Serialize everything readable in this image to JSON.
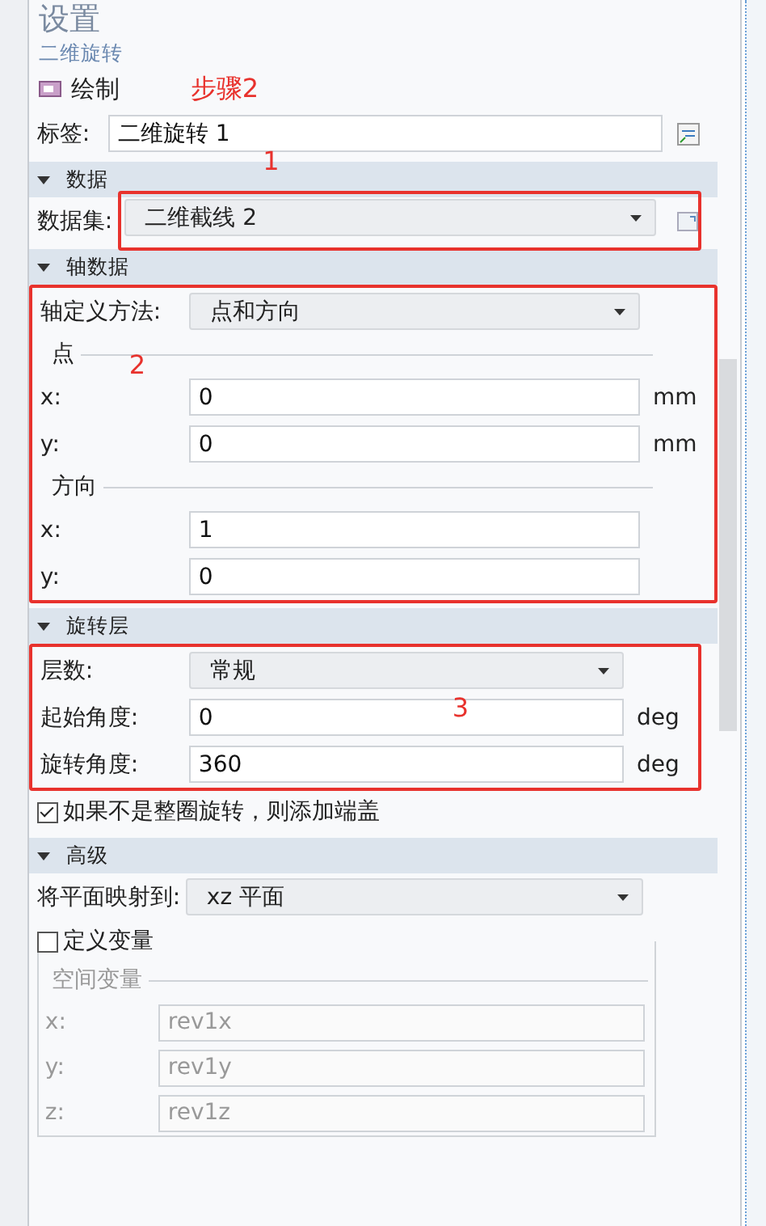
{
  "panel": {
    "title": "设置",
    "subtitle": "二维旋转",
    "action": "绘制",
    "annotation": "步骤2"
  },
  "label_field": {
    "label": "标签:",
    "value": "二维旋转 1"
  },
  "sections": [
    {
      "title": "数据",
      "expanded": true,
      "items": [
        {
          "kind": "combo",
          "label": "数据集:",
          "value": "二维截线 2",
          "highlight": "1"
        }
      ]
    },
    {
      "title": "轴数据",
      "expanded": true,
      "highlight": "2",
      "items": [
        {
          "kind": "combo",
          "label": "轴定义方法:",
          "value": "点和方向"
        },
        {
          "kind": "group",
          "title": "点",
          "disabled": false,
          "rows": [
            {
              "label": "x:",
              "value": "0",
              "unit": "mm"
            },
            {
              "label": "y:",
              "value": "0",
              "unit": "mm"
            }
          ]
        },
        {
          "kind": "group",
          "title": "方向",
          "disabled": false,
          "rows": [
            {
              "label": "x:",
              "value": "1"
            },
            {
              "label": "y:",
              "value": "0"
            }
          ]
        }
      ]
    },
    {
      "title": "旋转层",
      "expanded": true,
      "highlight": "3",
      "items": [
        {
          "kind": "combo",
          "label": "层数:",
          "value": "常规"
        },
        {
          "kind": "field",
          "label": "起始角度:",
          "value": "0",
          "unit": "deg"
        },
        {
          "kind": "field",
          "label": "旋转角度:",
          "value": "360",
          "unit": "deg"
        }
      ],
      "after": [
        {
          "kind": "checkbox",
          "label": "如果不是整圈旋转，则添加端盖",
          "checked": true
        }
      ]
    },
    {
      "title": "高级",
      "expanded": true,
      "items": [
        {
          "kind": "combo",
          "label": "将平面映射到:",
          "value": "xz 平面"
        },
        {
          "kind": "checkgroup",
          "label": "定义变量",
          "checked": false,
          "groups": [
            {
              "kind": "group",
              "title": "空间变量",
              "disabled": true,
              "rows": [
                {
                  "label": "x:",
                  "value": "rev1x"
                },
                {
                  "label": "y:",
                  "value": "rev1y"
                },
                {
                  "label": "z:",
                  "value": "rev1z"
                }
              ]
            }
          ]
        }
      ]
    }
  ]
}
